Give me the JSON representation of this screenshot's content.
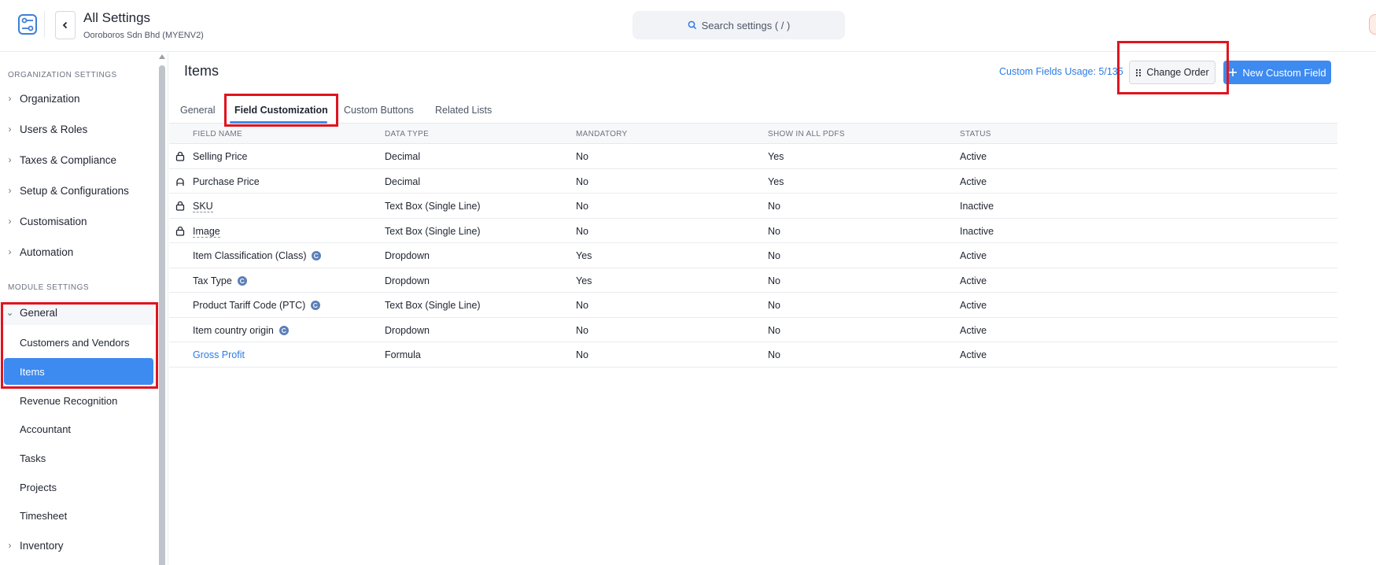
{
  "header": {
    "title": "All Settings",
    "subtitle": "Ooroboros Sdn Bhd (MYENV2)",
    "search_placeholder": "Search settings ( / )"
  },
  "sidebar": {
    "org_heading": "ORGANIZATION SETTINGS",
    "org_items": [
      "Organization",
      "Users & Roles",
      "Taxes & Compliance",
      "Setup & Configurations",
      "Customisation",
      "Automation"
    ],
    "module_heading": "MODULE SETTINGS",
    "general_label": "General",
    "general_children": [
      "Customers and Vendors",
      "Items",
      "Revenue Recognition",
      "Accountant",
      "Tasks",
      "Projects",
      "Timesheet"
    ],
    "active_child": "Items",
    "inventory_label": "Inventory"
  },
  "main": {
    "title": "Items",
    "usage_text": "Custom Fields Usage: 5/135",
    "change_order_label": "Change Order",
    "new_field_label": "New Custom Field",
    "tabs": [
      "General",
      "Field Customization",
      "Custom Buttons",
      "Related Lists"
    ],
    "active_tab": "Field Customization",
    "columns": [
      "FIELD NAME",
      "DATA TYPE",
      "MANDATORY",
      "SHOW IN ALL PDFS",
      "STATUS"
    ],
    "rows": [
      {
        "name": "Selling Price",
        "type": "Decimal",
        "mandatory": "No",
        "pdf": "Yes",
        "status": "Active"
      },
      {
        "name": "Purchase Price",
        "type": "Decimal",
        "mandatory": "No",
        "pdf": "Yes",
        "status": "Active"
      },
      {
        "name": "SKU",
        "type": "Text Box (Single Line)",
        "mandatory": "No",
        "pdf": "No",
        "status": "Inactive"
      },
      {
        "name": "Image",
        "type": "Text Box (Single Line)",
        "mandatory": "No",
        "pdf": "No",
        "status": "Inactive"
      },
      {
        "name": "Item Classification (Class)",
        "type": "Dropdown",
        "mandatory": "Yes",
        "pdf": "No",
        "status": "Active"
      },
      {
        "name": "Tax Type",
        "type": "Dropdown",
        "mandatory": "Yes",
        "pdf": "No",
        "status": "Active"
      },
      {
        "name": "Product Tariff Code (PTC)",
        "type": "Text Box (Single Line)",
        "mandatory": "No",
        "pdf": "No",
        "status": "Active"
      },
      {
        "name": "Item country origin",
        "type": "Dropdown",
        "mandatory": "No",
        "pdf": "No",
        "status": "Active"
      },
      {
        "name": "Gross Profit",
        "type": "Formula",
        "mandatory": "No",
        "pdf": "No",
        "status": "Active"
      }
    ]
  },
  "colors": {
    "accent": "#3d8af0",
    "highlight": "#e0141e",
    "link": "#2c7be5"
  }
}
